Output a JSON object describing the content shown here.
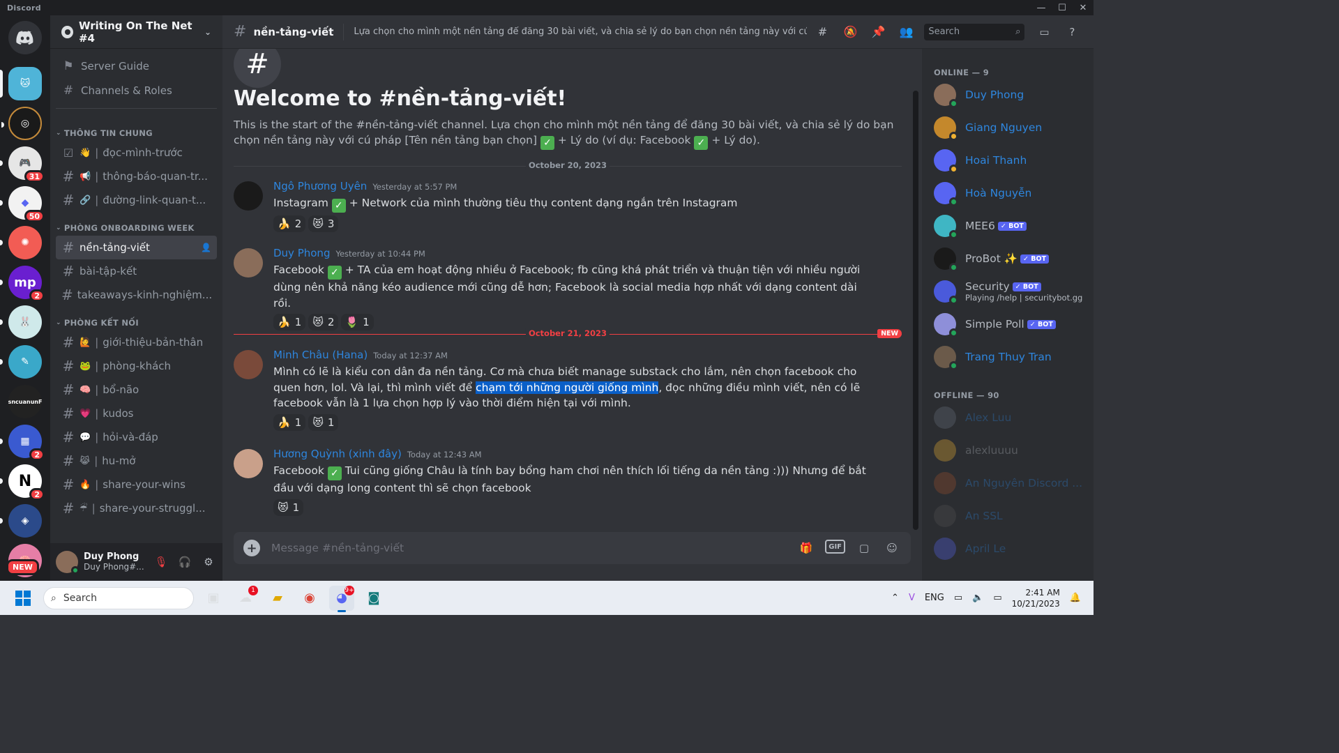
{
  "window": {
    "title": "Discord"
  },
  "server": {
    "name": "Writing On The Net #4"
  },
  "nav": [
    {
      "label": "Server Guide",
      "icon": "signpost-icon"
    },
    {
      "label": "Channels & Roles",
      "icon": "channels-roles-icon"
    }
  ],
  "categories": [
    {
      "name": "THÔNG TIN CHUNG",
      "channels": [
        {
          "name": "đọc-mình-trước",
          "emoji": "👋",
          "icon": "rules-checkbox-icon",
          "prefix": "☑"
        },
        {
          "name": "thông-báo-quan-tr...",
          "emoji": "📢",
          "icon": "hash-icon",
          "prefix": "#"
        },
        {
          "name": "đường-link-quan-t...",
          "emoji": "🔗",
          "icon": "hash-icon",
          "prefix": "#"
        }
      ]
    },
    {
      "name": "PHÒNG ONBOARDING WEEK",
      "channels": [
        {
          "name": "nền-tảng-viết",
          "emoji": "",
          "icon": "hash-icon",
          "prefix": "#",
          "active": true
        },
        {
          "name": "bài-tập-kết",
          "emoji": "",
          "icon": "hash-icon",
          "prefix": "#"
        },
        {
          "name": "takeaways-kinh-nghiệm...",
          "emoji": "",
          "icon": "hash-icon",
          "prefix": "#"
        }
      ]
    },
    {
      "name": "PHÒNG KẾT NỐI",
      "channels": [
        {
          "name": "giới-thiệu-bản-thân",
          "emoji": "🙋",
          "prefix": "#"
        },
        {
          "name": "phòng-khách",
          "emoji": "🐸",
          "prefix": "#"
        },
        {
          "name": "bổ-não",
          "emoji": "🧠",
          "prefix": "#"
        },
        {
          "name": "kudos",
          "emoji": "💗",
          "prefix": "#"
        },
        {
          "name": "hỏi-và-đáp",
          "emoji": "💬",
          "prefix": "#"
        },
        {
          "name": "hu-mở",
          "emoji": "😹",
          "prefix": "#"
        },
        {
          "name": "share-your-wins",
          "emoji": "🔥",
          "prefix": "#"
        },
        {
          "name": "share-your-struggl...",
          "emoji": "☔",
          "prefix": "#"
        }
      ]
    }
  ],
  "user": {
    "name": "Duy Phong",
    "tag": "Duy Phong#..."
  },
  "guild_badges": [
    "31",
    "50",
    "2",
    "2",
    "2",
    "2"
  ],
  "guild_new": "NEW",
  "channel": {
    "name": "nền-tảng-viết",
    "topic": "Lựa chọn cho mình một nền tảng để đăng 30 bài viết, và chia sẻ lý do bạn chọn nền tảng này với cú pháp [..."
  },
  "search": {
    "placeholder": "Search"
  },
  "welcome": {
    "title": "Welcome to #nền-tảng-viết!",
    "desc_a": "This is the start of the #nền-tảng-viết channel. Lựa chọn cho mình một nền tảng để đăng 30 bài viết, và chia sẻ lý do bạn chọn nền tảng này với cú pháp [Tên nền tảng bạn chọn] ",
    "desc_b": " + Lý do (ví dụ: Facebook ",
    "desc_c": " + Lý do)."
  },
  "dates": {
    "d1": "October 20, 2023",
    "d2": "October 21, 2023",
    "new": "NEW"
  },
  "messages": [
    {
      "author": "Ngô Phương Uyên",
      "time": "Yesterday at 5:57 PM",
      "pre": "Instagram ",
      "post": " + Network của mình thường tiêu thụ content dạng ngắn trên Instagram",
      "reactions": [
        {
          "emoji": "🍌",
          "count": "2"
        },
        {
          "emoji": "😻",
          "count": "3"
        }
      ]
    },
    {
      "author": "Duy Phong",
      "time": "Yesterday at 10:44 PM",
      "pre": "Facebook ",
      "post": " + TA của em hoạt động nhiều ở Facebook; fb cũng khá phát triển và thuận tiện với nhiều người dùng nên khả năng kéo audience mới cũng dễ hơn; Facebook là social media hợp nhất với dạng content dài rồi.",
      "reactions": [
        {
          "emoji": "🍌",
          "count": "1"
        },
        {
          "emoji": "😻",
          "count": "2"
        },
        {
          "emoji": "🌷",
          "count": "1"
        }
      ]
    },
    {
      "author": "Minh Châu (Hana)",
      "time": "Today at 12:37 AM",
      "pre": "Mình có lẽ là kiểu con dân đa nền tảng. Cơ mà chưa biết manage substack cho lắm, nên chọn facebook cho quen hơn, lol. Và lại, thì mình viết để ",
      "highlight": "chạm tới những người giống mình",
      "post": ", đọc những điều mình viết, nên có lẽ facebook vẫn là 1 lựa chọn hợp lý vào thời điểm hiện tại với mình.",
      "reactions": [
        {
          "emoji": "🍌",
          "count": "1"
        },
        {
          "emoji": "😻",
          "count": "1"
        }
      ]
    },
    {
      "author": "Hương Quỳnh (xinh đây)",
      "time": "Today at 12:43 AM",
      "pre": "Facebook ",
      "post": " Tui cũng giống Châu là tính bay bổng ham chơi nên thích lối tiếng da nền tảng :))) Nhưng để bắt đầu với dạng long content thì sẽ chọn facebook",
      "reactions": [
        {
          "emoji": "😻",
          "count": "1"
        }
      ]
    }
  ],
  "composer": {
    "placeholder": "Message #nền-tảng-viết",
    "gif": "GIF"
  },
  "members": {
    "online_label": "ONLINE — 9",
    "offline_label": "OFFLINE — 90",
    "online": [
      {
        "name": "Duy Phong",
        "color": "#8a6d5a",
        "status": "#23a55a"
      },
      {
        "name": "Giang Nguyen",
        "color": "#c4882c",
        "status": "#f0b232"
      },
      {
        "name": "Hoai Thanh",
        "color": "#5865f2",
        "status": "#f0b232"
      },
      {
        "name": "Hoà Nguyễn",
        "color": "#5865f2",
        "status": "#23a55a"
      },
      {
        "name": "MEE6",
        "color": "#3fb6c4",
        "status": "#23a55a",
        "bot": true,
        "plain": true
      },
      {
        "name": "ProBot ✨",
        "color": "#1a1a1a",
        "status": "#23a55a",
        "bot": true,
        "plain": true
      },
      {
        "name": "Security",
        "color": "#4a5adb",
        "status": "#23a55a",
        "bot": true,
        "plain": true,
        "sub": "Playing /help | securitybot.gg"
      },
      {
        "name": "Simple Poll",
        "color": "#8e8fd9",
        "status": "#23a55a",
        "bot": true,
        "plain": true
      },
      {
        "name": "Trang Thuy Tran",
        "color": "#6b5a4a",
        "status": "#23a55a"
      }
    ],
    "offline": [
      {
        "name": "Alex Luu",
        "color": "#6b7280"
      },
      {
        "name": "alexluuuu",
        "color": "#f0b232",
        "plain": true
      },
      {
        "name": "An Nguyên Discord ...",
        "color": "#a0522d"
      },
      {
        "name": "An SSL",
        "color": "#555"
      },
      {
        "name": "April Le",
        "color": "#5865f2"
      }
    ],
    "bot_label": "✓ BOT"
  },
  "taskbar": {
    "search": "Search",
    "lang": "ENG",
    "time": "2:41 AM",
    "date": "10/21/2023"
  }
}
